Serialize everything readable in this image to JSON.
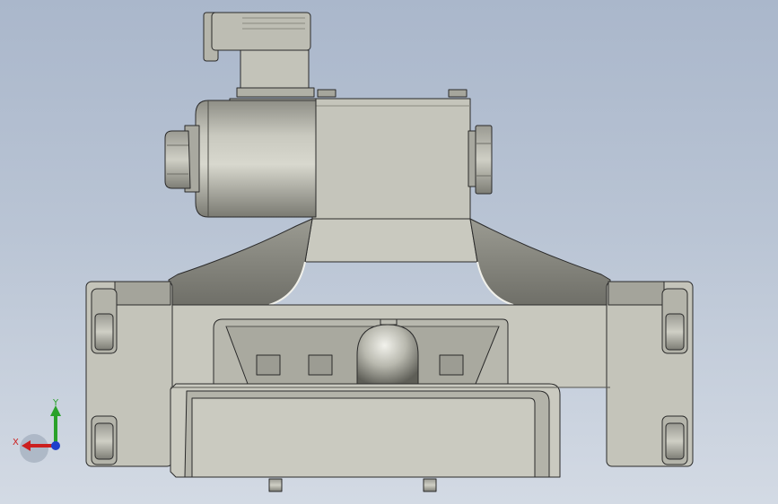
{
  "viewport": {
    "background_top": "#aab7cb",
    "background_bottom": "#d3dae4"
  },
  "model": {
    "body_color": "#c6c6bc",
    "edge_color": "#2a2a2a",
    "shadow_color": "#8d8d84"
  },
  "triad": {
    "x_label": "X",
    "y_label": "Y",
    "x_color": "#cc1f1f",
    "y_color": "#2aa12a",
    "z_color": "#1f3fcc"
  }
}
